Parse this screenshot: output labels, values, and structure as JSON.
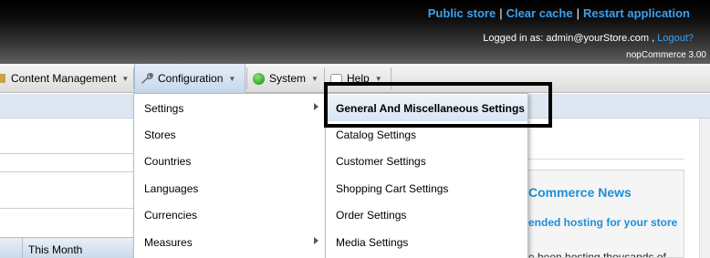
{
  "header": {
    "links": [
      "Public store",
      "Clear cache",
      "Restart application"
    ],
    "logged_in_text": "Logged in as: admin@yourStore.com ,",
    "logout_label": "Logout?",
    "version": "nopCommerce 3.00"
  },
  "menu": {
    "content_management": "Content Management",
    "configuration": "Configuration",
    "system": "System",
    "help": "Help"
  },
  "configuration_menu": [
    "Settings",
    "Stores",
    "Countries",
    "Languages",
    "Currencies",
    "Measures"
  ],
  "settings_submenu": [
    "General And Miscellaneous Settings",
    "Catalog Settings",
    "Customer Settings",
    "Shopping Cart Settings",
    "Order Settings",
    "Media Settings"
  ],
  "stats": {
    "column": "This Month"
  },
  "news": {
    "title": "Commerce News",
    "subtitle": "ended hosting for your store",
    "body": "e been hosting thousands of"
  },
  "colors": {
    "link_blue": "#3aa0ee",
    "news_blue": "#1f8fd6",
    "system_icon_green": "#3cb034"
  }
}
